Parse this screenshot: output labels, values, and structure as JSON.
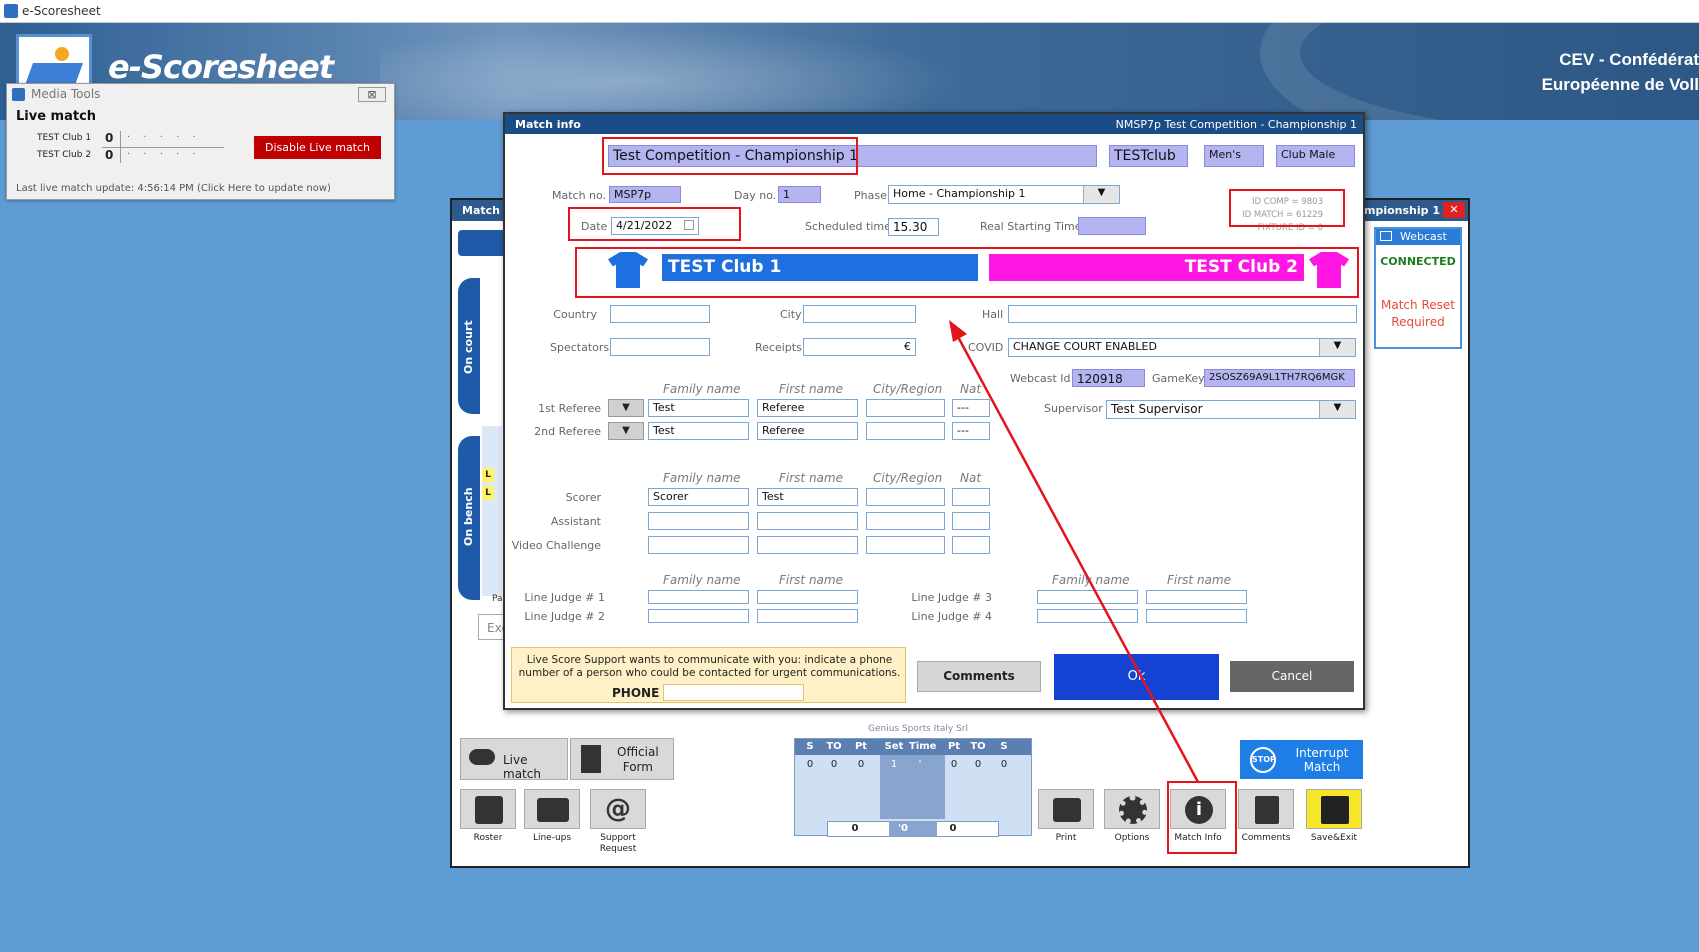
{
  "window": {
    "title": "e-Scoresheet"
  },
  "banner": {
    "app_name": "e-Scoresheet",
    "org_line1": "CEV - Confédérat",
    "org_line2": "Européenne de Voll"
  },
  "media_tools": {
    "title": "Media Tools",
    "close_label": "⊠",
    "section": "Live match",
    "teams": [
      {
        "name": "TEST Club 1",
        "score": "0"
      },
      {
        "name": "TEST Club 2",
        "score": "0"
      }
    ],
    "dots": "· · · · ·",
    "disable_label": "Disable Live match",
    "last_update": "Last live match update: 4:56:14 PM (Click Here to update now)"
  },
  "match_window": {
    "title": "Match S",
    "title_right": "ampionship 1",
    "close_label": "✕",
    "side_tabs": [
      "On court",
      "On bench"
    ],
    "libero_marks": [
      "L",
      "L"
    ],
    "snippet_pa": "Pa",
    "search_placeholder": "Exc"
  },
  "webcast": {
    "title": "Webcast",
    "status": "CONNECTED",
    "notice_1": "Match Reset",
    "notice_2": "Required"
  },
  "dialog": {
    "title": "Match info",
    "title_right": "NMSP7p   Test Competition - Championship 1",
    "competition": "Test Competition - Championship 1",
    "club": "TESTclub",
    "gender": "Men's",
    "category": "Club Male",
    "match_no_label": "Match no.",
    "match_no": "MSP7p",
    "day_no_label": "Day no.",
    "day_no": "1",
    "phase_label": "Phase",
    "phase": "Home - Championship 1",
    "ids": {
      "comp": "ID COMP = 9803",
      "match": "ID MATCH = 61229",
      "fixture": "FIXTURE ID = 0"
    },
    "date_label": "Date",
    "date": "4/21/2022",
    "scheduled_label": "Scheduled time",
    "scheduled": "15.30",
    "real_start_label": "Real Starting Time",
    "real_start": "",
    "team_a": "TEST Club 1",
    "team_b": "TEST Club 2",
    "team_a_color": "#1e6fe0",
    "team_b_color": "#ff16e2",
    "country_label": "Country",
    "city_label": "City",
    "hall_label": "Hall",
    "spectators_label": "Spectators",
    "receipts_label": "Receipts",
    "currency": "€",
    "covid_label": "COVID",
    "covid_value": "CHANGE COURT ENABLED",
    "webcast_id_label": "Webcast Id",
    "webcast_id": "120918",
    "gamekey_label": "GameKey",
    "gamekey": "2SOSZ69A9L1TH7RQ6MGK",
    "supervisor_label": "Supervisor",
    "supervisor": "Test Supervisor",
    "col_family": "Family name",
    "col_first": "First name",
    "col_city": "City/Region",
    "col_nat": "Nat",
    "referee1_label": "1st Referee",
    "referee1": {
      "family": "Test",
      "first": "Referee",
      "nat": "---"
    },
    "referee2_label": "2nd Referee",
    "referee2": {
      "family": "Test",
      "first": "Referee",
      "nat": "---"
    },
    "scorer_label": "Scorer",
    "scorer": {
      "family": "Scorer",
      "first": "Test"
    },
    "assistant_label": "Assistant",
    "video_label": "Video Challenge",
    "lj1_label": "Line Judge # 1",
    "lj2_label": "Line Judge # 2",
    "lj3_label": "Line Judge # 3",
    "lj4_label": "Line Judge # 4",
    "live_support_msg": "Live Score Support wants to communicate with you: indicate a phone number of a person who could be contacted for urgent communications.",
    "phone_label": "PHONE",
    "comments_label": "Comments",
    "ok_label": "Ok",
    "cancel_label": "Cancel",
    "dropdown_arrow": "▼"
  },
  "toolbar": {
    "live_match": "Live match",
    "official_form_1": "Official",
    "official_form_2": "Form",
    "roster": "Roster",
    "lineups": "Line-ups",
    "support_1": "Support",
    "support_2": "Request",
    "print": "Print",
    "options": "Options",
    "match_info": "Match Info",
    "comments": "Comments",
    "save_exit": "Save&Exit",
    "interrupt_1": "Interrupt",
    "interrupt_2": "Match",
    "stop": "STOP",
    "genius": "Genius Sports Italy Srl"
  },
  "score_table": {
    "headers": [
      "S",
      "TO",
      "Pt",
      "Set",
      "Time",
      "Pt",
      "TO",
      "S"
    ],
    "row": [
      "0",
      "0",
      "0",
      "1",
      "'",
      "0",
      "0",
      "0"
    ],
    "footer": [
      "0",
      "'0",
      "0"
    ]
  },
  "colors": {
    "annotation_red": "#e3141b",
    "header_blue": "#1a4c86",
    "page_bg": "#5d9cd4"
  }
}
